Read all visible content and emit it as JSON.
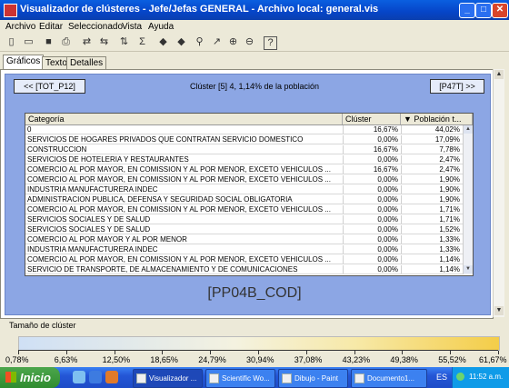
{
  "window": {
    "title": "Visualizador de clústeres - Jefe/Jefas GENERAL - Archivo local: general.vis",
    "controls": [
      "_",
      "□",
      "✕"
    ]
  },
  "menu": [
    "Archivo",
    "Editar",
    "Seleccionado",
    "Vista",
    "Ayuda"
  ],
  "toolbar": {
    "icons": [
      "new-icon",
      "open-icon",
      "save-icon",
      "print-icon",
      "refresh-icon",
      "swap-icon",
      "sort-icon",
      "filter-icon",
      "back-icon",
      "forward-icon",
      "find-icon",
      "graph-icon",
      "zoom-in-icon",
      "zoom-out-icon",
      "help-icon"
    ],
    "glyphs": [
      "▯",
      "▭",
      "■",
      "⎙",
      "⇄",
      "⇆",
      "⇅",
      "Σ",
      "◆",
      "◆",
      "⚲",
      "↗",
      "⊕",
      "⊖",
      "?"
    ]
  },
  "tabs": [
    "Gráficos",
    "Texto",
    "Detalles"
  ],
  "nav": {
    "prev": "<< [TOT_P12]",
    "next": "[P47T] >>",
    "title": "Clúster [5] 4, 1,14% de la población"
  },
  "table": {
    "headers": [
      "Categoría",
      "Clúster",
      "▼ Población t..."
    ],
    "rows": [
      [
        "0",
        "16,67%",
        "44,02%"
      ],
      [
        "SERVICIOS DE HOGARES PRIVADOS QUE CONTRATAN SERVICIO DOMESTICO",
        "0,00%",
        "17,09%"
      ],
      [
        "CONSTRUCCION",
        "16,67%",
        "7,78%"
      ],
      [
        "SERVICIOS DE HOTELERIA Y RESTAURANTES",
        "0,00%",
        "2,47%"
      ],
      [
        "COMERCIO AL POR MAYOR, EN COMISSION Y AL POR MENOR, EXCETO VEHICULOS ...",
        "16,67%",
        "2,47%"
      ],
      [
        "COMERCIO AL POR MAYOR, EN COMISSION Y AL POR MENOR, EXCETO VEHICULOS ...",
        "0,00%",
        "1,90%"
      ],
      [
        "INDUSTRIA MANUFACTURERA INDEC",
        "0,00%",
        "1,90%"
      ],
      [
        "ADMINISTRACION PUBLICA, DEFENSA Y SEGURIDAD SOCIAL OBLIGATORIA",
        "0,00%",
        "1,90%"
      ],
      [
        "COMERCIO AL POR MAYOR, EN COMISSION Y AL POR MENOR, EXCETO VEHICULOS ...",
        "0,00%",
        "1,71%"
      ],
      [
        "SERVICIOS SOCIALES Y DE SALUD",
        "0,00%",
        "1,71%"
      ],
      [
        "SERVICIOS SOCIALES Y DE SALUD",
        "0,00%",
        "1,52%"
      ],
      [
        "COMERCIO AL POR MAYOR Y AL POR MENOR",
        "0,00%",
        "1,33%"
      ],
      [
        "INDUSTRIA MANUFACTURERA INDEC",
        "0,00%",
        "1,33%"
      ],
      [
        "COMERCIO AL POR MAYOR, EN COMISSION Y AL POR MENOR, EXCETO VEHICULOS ...",
        "0,00%",
        "1,14%"
      ],
      [
        "SERVICIO DE TRANSPORTE, DE ALMACENAMIENTO Y DE COMUNICACIONES",
        "0,00%",
        "1,14%"
      ]
    ]
  },
  "variable": "[PP04B_COD]",
  "cluster_size": {
    "label": "Tamaño de clúster",
    "scale": [
      "0,78%",
      "6,63%",
      "12,50%",
      "18,65%",
      "24,79%",
      "30,94%",
      "37,08%",
      "43,23%",
      "49,38%",
      "55,52%",
      "61,67%"
    ]
  },
  "taskbar": {
    "start": "Inicio",
    "tasks": [
      "Visualizador ...",
      "Scientific Wo...",
      "Dibujo - Paint",
      "Documento1..."
    ],
    "lang": "ES",
    "clock": "11:52 a.m."
  }
}
